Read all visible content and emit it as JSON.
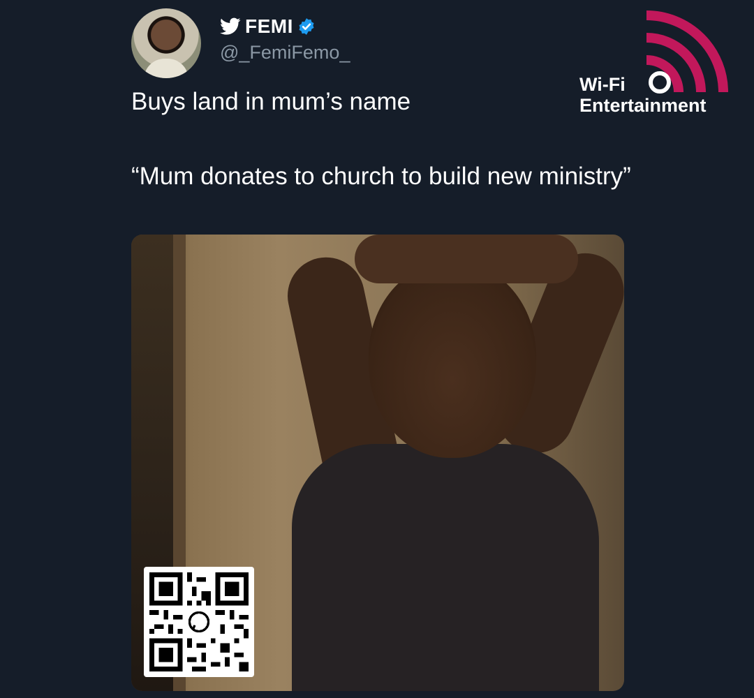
{
  "tweet": {
    "display_name": "FEMI",
    "handle": "@_FemiFemo_",
    "line1": "Buys land in mum’s name",
    "line2": "“Mum donates to church to build new ministry”",
    "icons": [
      "twitter-bird-icon",
      "verified-badge-icon"
    ],
    "verified_color": "#1d9bf0"
  },
  "watermark": {
    "line1": "Wi-Fi",
    "line2": "Entertainment",
    "accent_color": "#c2185b"
  },
  "colors": {
    "background": "#151d29",
    "text": "#ffffff",
    "handle": "#8b98a5"
  }
}
